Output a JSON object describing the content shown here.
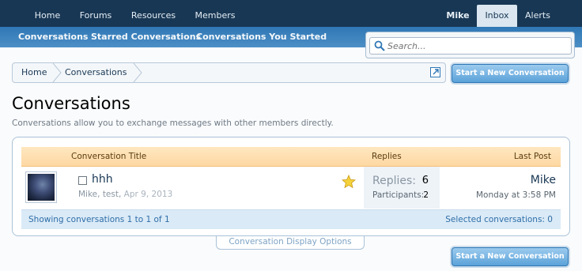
{
  "nav": {
    "tabs": [
      {
        "label": "Home"
      },
      {
        "label": "Forums"
      },
      {
        "label": "Resources"
      },
      {
        "label": "Members"
      }
    ],
    "user": "Mike",
    "inbox": "Inbox",
    "alerts": "Alerts"
  },
  "subnav": {
    "links": [
      "Conversations",
      "Starred Conversations",
      "Conversations You Started"
    ]
  },
  "search": {
    "placeholder": "Search...",
    "value": ""
  },
  "breadcrumb": {
    "items": [
      "Home",
      "Conversations"
    ]
  },
  "buttons": {
    "start_top": "Start a New Conversation",
    "start_bottom": "Start a New Conversation"
  },
  "page": {
    "title": "Conversations",
    "description": "Conversations allow you to exchange messages with other members directly."
  },
  "table": {
    "headers": {
      "title": "Conversation Title",
      "replies": "Replies",
      "last_post": "Last Post"
    },
    "rows": [
      {
        "title": "hhh",
        "participants_text": "Mike, test,",
        "date": "Apr 9, 2013",
        "replies_label": "Replies:",
        "replies_value": "6",
        "participants_label": "Participants:",
        "participants_value": "2",
        "last_post_user": "Mike",
        "last_post_time": "Monday at 3:58 PM"
      }
    ],
    "footer_left": "Showing conversations 1 to 1 of 1",
    "footer_right": "Selected conversations: 0"
  },
  "display_options": "Conversation Display Options",
  "colors": {
    "nav_dark": "#183754",
    "nav_blue": "#2f77b5",
    "header_orange": "#fdd8a2",
    "link": "#183754"
  }
}
